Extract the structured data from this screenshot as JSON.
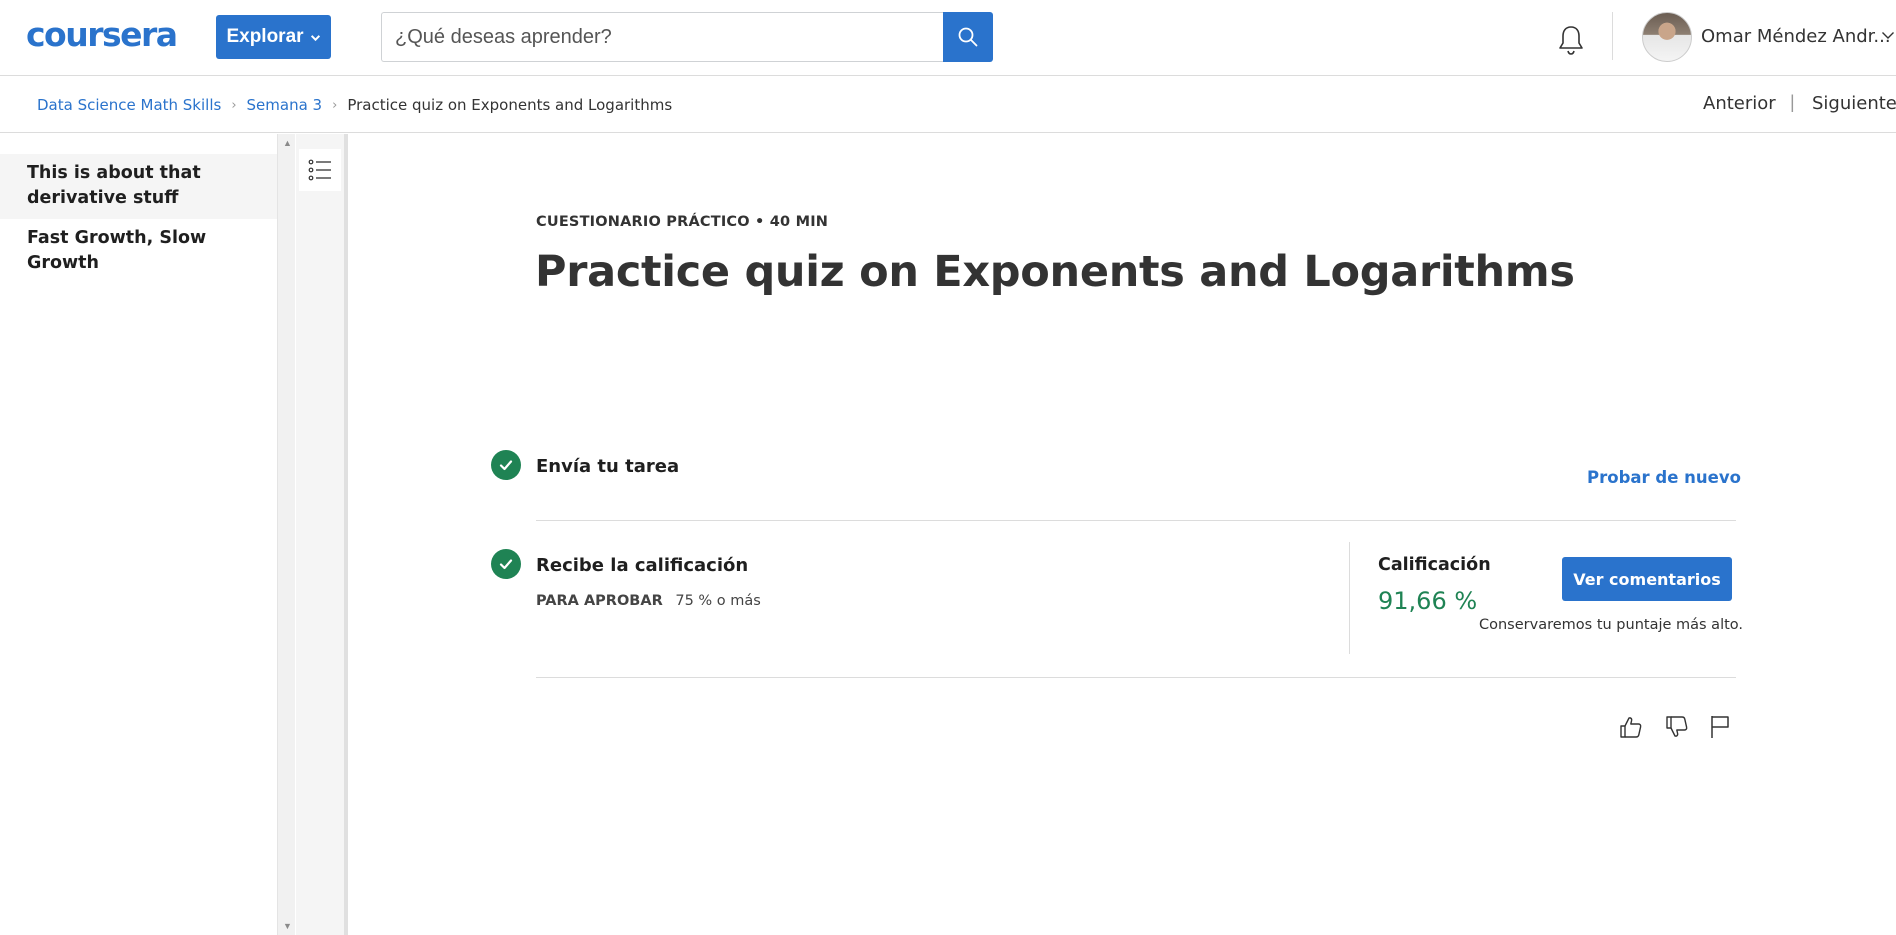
{
  "header": {
    "logo_text": "coursera",
    "explore_label": "Explorar",
    "search_placeholder": "¿Qué deseas aprender?",
    "user_name": "Omar Méndez Andr..."
  },
  "breadcrumb": {
    "items": [
      "Data Science Math Skills",
      "Semana 3"
    ],
    "current": "Practice quiz on Exponents and Logarithms"
  },
  "nav": {
    "previous": "Anterior",
    "separator": "|",
    "next": "Siguiente"
  },
  "sidebar": {
    "items": [
      {
        "label": "This is about that derivative stuff",
        "active": true
      },
      {
        "label": "Fast Growth, Slow Growth",
        "active": false
      }
    ]
  },
  "main": {
    "eyebrow": "CUESTIONARIO PRÁCTICO • 40 MIN",
    "title": "Practice quiz on Exponents and Logarithms",
    "step1": {
      "title": "Envía tu tarea",
      "action": "Probar de nuevo"
    },
    "step2": {
      "title": "Recibe la calificación",
      "pass_label": "PARA APROBAR",
      "pass_value": "75 % o más",
      "grade_label": "Calificación",
      "grade_value": "91,66 %",
      "feedback_button": "Ver comentarios",
      "note": "Conservaremos tu puntaje más alto."
    }
  },
  "colors": {
    "brand_blue": "#2a73cc",
    "success_green": "#1f8354"
  },
  "icons": [
    "search-icon",
    "bell-icon",
    "chevron-down-icon",
    "list-icon",
    "check-icon",
    "thumbs-up-icon",
    "thumbs-down-icon",
    "flag-icon"
  ]
}
